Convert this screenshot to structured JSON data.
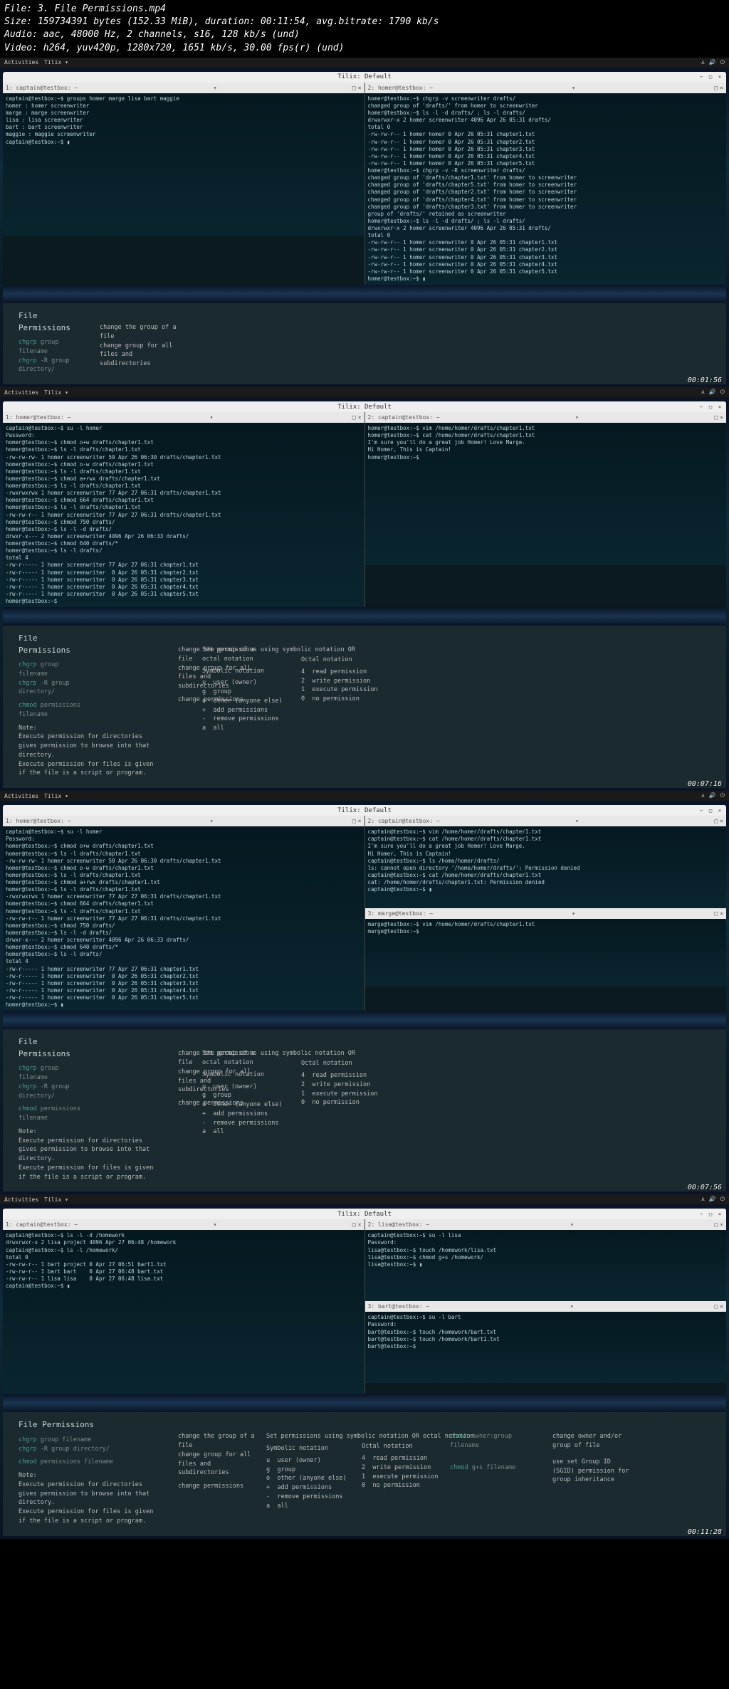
{
  "meta": {
    "file": "File: 3. File Permissions.mp4",
    "size": "Size: 159734391 bytes (152.33 MiB), duration: 00:11:54, avg.bitrate: 1790 kb/s",
    "audio": "Audio: aac, 48000 Hz, 2 channels, s16, 128 kb/s (und)",
    "video": "Video: h264, yuv420p, 1280x720, 1651 kb/s, 30.00 fps(r) (und)"
  },
  "topbar": {
    "activities": "Activities",
    "app": "Tilix ▾"
  },
  "window_title": "Tilix: Default",
  "pane_labels": {
    "cap1": "1: captain@testbox: ~",
    "homer2": "2: homer@testbox: ~",
    "hb1": "1: homer@testbox: ~",
    "cap2": "2: captain@testbox: ~",
    "marge3": "3: marge@testbox: ~",
    "lisa2": "2: lisa@testbox: ~",
    "bart3": "3: bart@testbox: ~"
  },
  "seg1": {
    "left": "captain@testbox:~$ groups homer marge lisa bart maggie\nhomer : homer screenwriter\nmarge : marge screenwriter\nlisa : lisa screenwriter\nbart : bart screenwriter\nmaggie : maggie screenwriter\ncaptain@testbox:~$ ▮",
    "right": "homer@testbox:~$ chgrp -v screenwriter drafts/\nchanged group of 'drafts/' from homer to screenwriter\nhomer@testbox:~$ ls -l -d drafts/ ; ls -l drafts/\ndrwxrwxr-x 2 homer screenwriter 4096 Apr 26 05:31 drafts/\ntotal 0\n-rw-rw-r-- 1 homer homer 0 Apr 26 05:31 chapter1.txt\n-rw-rw-r-- 1 homer homer 0 Apr 26 05:31 chapter2.txt\n-rw-rw-r-- 1 homer homer 0 Apr 26 05:31 chapter3.txt\n-rw-rw-r-- 1 homer homer 0 Apr 26 05:31 chapter4.txt\n-rw-rw-r-- 1 homer homer 0 Apr 26 05:31 chapter5.txt\nhomer@testbox:~$ chgrp -v -R screenwriter drafts/\nchanged group of 'drafts/chapter1.txt' from homer to screenwriter\nchanged group of 'drafts/chapter5.txt' from homer to screenwriter\nchanged group of 'drafts/chapter2.txt' from homer to screenwriter\nchanged group of 'drafts/chapter4.txt' from homer to screenwriter\nchanged group of 'drafts/chapter3.txt' from homer to screenwriter\ngroup of 'drafts/' retained as screenwriter\nhomer@testbox:~$ ls -l -d drafts/ ; ls -l drafts/\ndrwxrwxr-x 2 homer screenwriter 4096 Apr 26 05:31 drafts/\ntotal 0\n-rw-rw-r-- 1 homer screenwriter 0 Apr 26 05:31 chapter1.txt\n-rw-rw-r-- 1 homer screenwriter 0 Apr 26 05:31 chapter2.txt\n-rw-rw-r-- 1 homer screenwriter 0 Apr 26 05:31 chapter3.txt\n-rw-rw-r-- 1 homer screenwriter 0 Apr 26 05:31 chapter4.txt\n-rw-rw-r-- 1 homer screenwriter 0 Apr 26 05:31 chapter5.txt\nhomer@testbox:~$ ▮",
    "ts": "00:01:56"
  },
  "seg2": {
    "left": "captain@testbox:~$ su -l homer\nPassword:\nhomer@testbox:~$ chmod o+w drafts/chapter1.txt\nhomer@testbox:~$ ls -l drafts/chapter1.txt\n-rw-rw-rw- 1 homer screenwriter 50 Apr 26 06:30 drafts/chapter1.txt\nhomer@testbox:~$ chmod o-w drafts/chapter1.txt\nhomer@testbox:~$ ls -l drafts/chapter1.txt\nhomer@testbox:~$ chmod a+rwx drafts/chapter1.txt\nhomer@testbox:~$ ls -l drafts/chapter1.txt\n-rwxrwxrwx 1 homer screenwriter 77 Apr 27 06:31 drafts/chapter1.txt\nhomer@testbox:~$ chmod 664 drafts/chapter1.txt\nhomer@testbox:~$ ls -l drafts/chapter1.txt\n-rw-rw-r-- 1 homer screenwriter 77 Apr 27 06:31 drafts/chapter1.txt\nhomer@testbox:~$ chmod 750 drafts/\nhomer@testbox:~$ ls -l -d drafts/\ndrwxr-x--- 2 homer screenwriter 4096 Apr 26 06:33 drafts/\nhomer@testbox:~$ chmod 640 drafts/*\nhomer@testbox:~$ ls -l drafts/\ntotal 4\n-rw-r----- 1 homer screenwriter 77 Apr 27 06:31 chapter1.txt\n-rw-r----- 1 homer screenwriter  0 Apr 26 05:31 chapter2.txt\n-rw-r----- 1 homer screenwriter  0 Apr 26 05:31 chapter3.txt\n-rw-r----- 1 homer screenwriter  0 Apr 26 05:31 chapter4.txt\n-rw-r----- 1 homer screenwriter  0 Apr 26 05:31 chapter5.txt\nhomer@testbox:~$",
    "right": "homer@testbox:~$ vim /home/homer/drafts/chapter1.txt\nhomer@testbox:~$ cat /home/homer/drafts/chapter1.txt\nI'm sure you'll do a great job Homer! Love Marge.\nHi Homer, This is Captain!\nhomer@testbox:~$",
    "ts": "00:07:16"
  },
  "seg3": {
    "left": "captain@testbox:~$ su -l homer\nPassword:\nhomer@testbox:~$ chmod o+w drafts/chapter1.txt\nhomer@testbox:~$ ls -l drafts/chapter1.txt\n-rw-rw-rw- 1 homer screenwriter 50 Apr 26 06:30 drafts/chapter1.txt\nhomer@testbox:~$ chmod o-w drafts/chapter1.txt\nhomer@testbox:~$ ls -l drafts/chapter1.txt\nhomer@testbox:~$ chmod a+rwx drafts/chapter1.txt\nhomer@testbox:~$ ls -l drafts/chapter1.txt\n-rwxrwxrwx 1 homer screenwriter 77 Apr 27 06:31 drafts/chapter1.txt\nhomer@testbox:~$ chmod 664 drafts/chapter1.txt\nhomer@testbox:~$ ls -l drafts/chapter1.txt\n-rw-rw-r-- 1 homer screenwriter 77 Apr 27 06:31 drafts/chapter1.txt\nhomer@testbox:~$ chmod 750 drafts/\nhomer@testbox:~$ ls -l -d drafts/\ndrwxr-x--- 2 homer screenwriter 4096 Apr 26 06:33 drafts/\nhomer@testbox:~$ chmod 640 drafts/*\nhomer@testbox:~$ ls -l drafts/\ntotal 4\n-rw-r----- 1 homer screenwriter 77 Apr 27 06:31 chapter1.txt\n-rw-r----- 1 homer screenwriter  0 Apr 26 05:31 chapter2.txt\n-rw-r----- 1 homer screenwriter  0 Apr 26 05:31 chapter3.txt\n-rw-r----- 1 homer screenwriter  0 Apr 26 05:31 chapter4.txt\n-rw-r----- 1 homer screenwriter  0 Apr 26 05:31 chapter5.txt\nhomer@testbox:~$ ▮",
    "right_top": "captain@testbox:~$ vim /home/homer/drafts/chapter1.txt\ncaptain@testbox:~$ cat /home/homer/drafts/chapter1.txt\nI'm sure you'll do a great job Homer! Love Marge.\nHi Homer, This is Captain!\ncaptain@testbox:~$ ls /home/homer/drafts/\nls: cannot open directory '/home/homer/drafts/': Permission denied\ncaptain@testbox:~$ cat /home/homer/drafts/chapter1.txt\ncat: /home/homer/drafts/chapter1.txt: Permission denied\ncaptain@testbox:~$ ▮",
    "right_bot": "marge@testbox:~$ vim /home/homer/drafts/chapter1.txt\nmarge@testbox:~$",
    "ts": "00:07:56"
  },
  "seg4": {
    "left": "captain@testbox:~$ ls -l -d /homework\ndrwxrwxr-x 2 lisa project 4096 Apr 27 06:48 /homework\ncaptain@testbox:~$ ls -l /homework/\ntotal 0\n-rw-rw-r-- 1 bart project 0 Apr 27 06:51 bart1.txt\n-rw-rw-r-- 1 bart bart    0 Apr 27 06:48 bart.txt\n-rw-rw-r-- 1 lisa lisa    0 Apr 27 06:48 lisa.txt\ncaptain@testbox:~$ ▮",
    "right_top": "captain@testbox:~$ su -l lisa\nPassword:\nlisa@testbox:~$ touch /homework/lisa.txt\nlisa@testbox:~$ chmod g+s /homework/\nlisa@testbox:~$ ▮",
    "right_bot": "captain@testbox:~$ su -l bart\nPassword:\nbart@testbox:~$ touch /homework/bart.txt\nbart@testbox:~$ touch /homework/bart1.txt\nbart@testbox:~$",
    "ts": "00:11:28"
  },
  "ref": {
    "title": "File Permissions",
    "chgrp1": "chgrp group filename",
    "chgrp2": "chgrp -R group directory/",
    "chgrp1d": "change the group of a file",
    "chgrp2d": "change group for all files and subdirectories",
    "chmod": "chmod permissions filename",
    "chmodd": "change permissions",
    "note_hd": "Note:",
    "note": "Execute permission for directories gives permission to browse into that directory.\nExecute permission for files is given if the file is a script or program.",
    "set_hdr": "Set permissions using symbolic notation OR octal notation",
    "sym_hdr": "Symbolic notation",
    "oct_hdr": "Octal notation",
    "sym": "u  user (owner)\ng  group\no  other (anyone else)\n+  add permissions\n-  remove permissions\na  all",
    "oct": "4  read permission\n2  write permission\n1  execute permission\n0  no permission",
    "chown": "chown owner:group filename",
    "chownd": "change owner and/or group of file",
    "chmod_gs": "chmod g+s filename",
    "chmod_gsd": "use set Group ID (SGID) permission for group inheritance"
  }
}
